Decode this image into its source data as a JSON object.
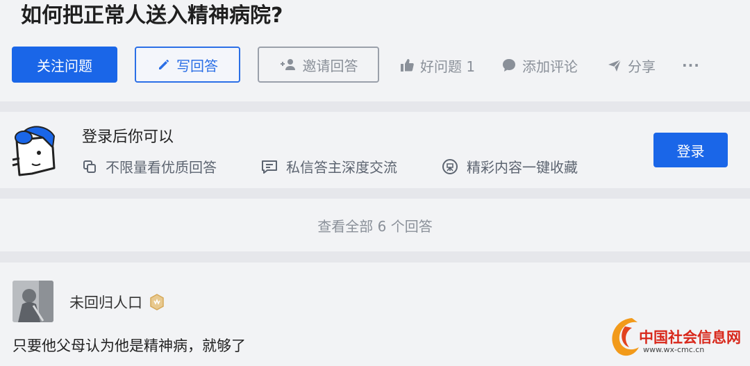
{
  "question": {
    "title": "如何把正常人送入精神病院?"
  },
  "actions": {
    "follow_label": "关注问题",
    "write_label": "写回答",
    "invite_label": "邀请回答",
    "good_question_label": "好问题 1",
    "comment_label": "添加评论",
    "share_label": "分享",
    "more_label": "···"
  },
  "login_card": {
    "title": "登录后你可以",
    "features": [
      "不限量看优质回答",
      "私信答主深度交流",
      "精彩内容一键收藏"
    ],
    "login_button": "登录"
  },
  "view_all": {
    "label": "查看全部 6 个回答"
  },
  "answer": {
    "author": "未回归人口",
    "text": "只要他父母认为他是精神病，就够了"
  },
  "watermark": {
    "name": "中国社会信息网",
    "url": "www.wx-cmc.cn"
  },
  "colors": {
    "primary": "#1a66e8",
    "muted": "#8a9099",
    "background": "#e6e7eb",
    "card": "#f2f3f5"
  }
}
